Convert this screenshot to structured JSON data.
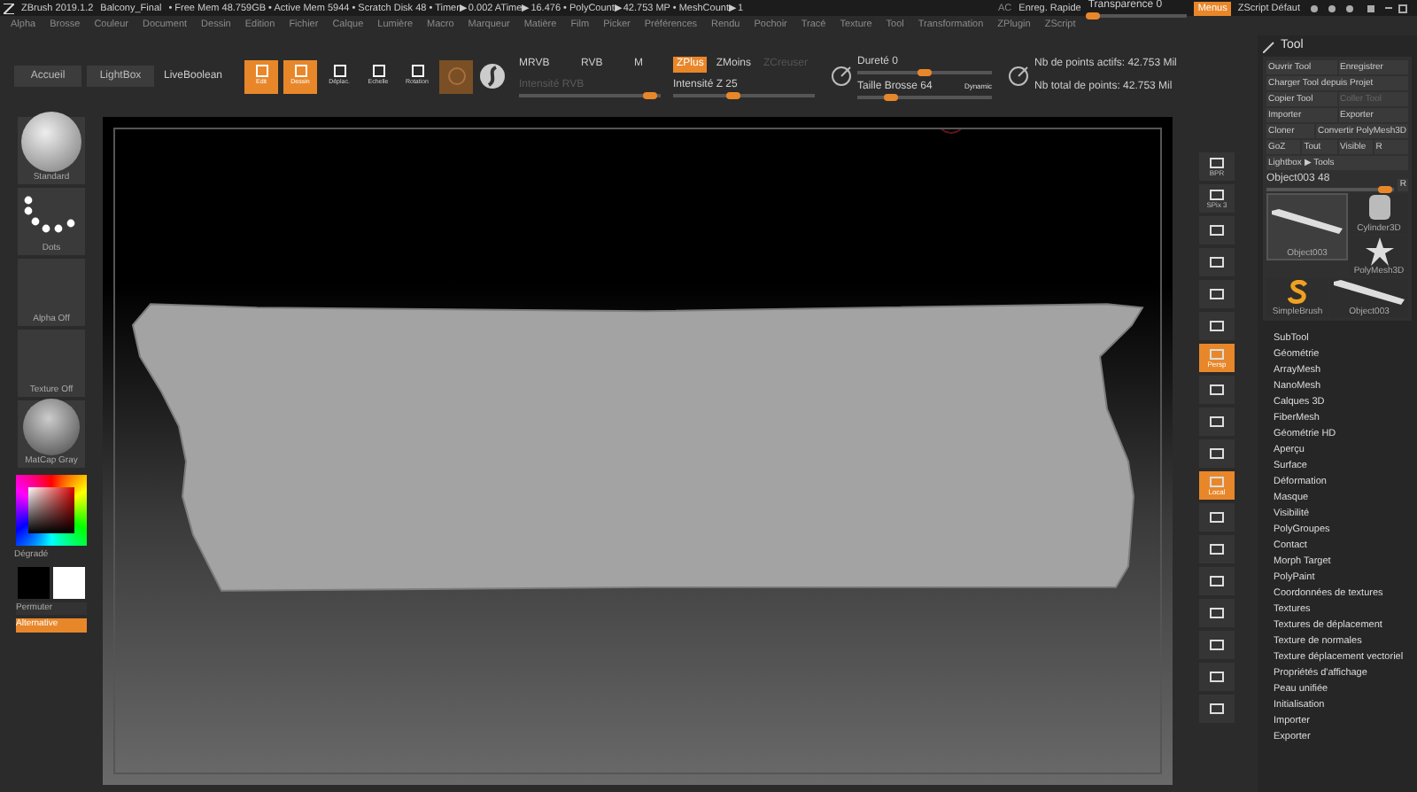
{
  "title_bar": {
    "app": "ZBrush 2019.1.2",
    "file": "Balcony_Final",
    "stats": "• Free Mem 48.759GB • Active Mem 5944 • Scratch Disk 48 • Timer▶0.002 ATime▶16.476 • PolyCount▶42.753 MP • MeshCount▶1",
    "ac": "AC",
    "quick_save": "Enreg. Rapide",
    "transparency": {
      "label": "Transparence 0",
      "level": 0.05
    },
    "menus_button": {
      "label": "Menus",
      "selected": true
    },
    "zscript": "ZScript Défaut"
  },
  "menu_bar": [
    "Alpha",
    "Brosse",
    "Couleur",
    "Document",
    "Dessin",
    "Edition",
    "Fichier",
    "Calque",
    "Lumière",
    "Macro",
    "Marqueur",
    "Matière",
    "Film",
    "Picker",
    "Préférences",
    "Rendu",
    "Pochoir",
    "Tracé",
    "Texture",
    "Tool",
    "Transformation",
    "ZPlugin",
    "ZScript"
  ],
  "toolbar": {
    "nav_buttons": [
      "Accueil",
      "LightBox",
      "LiveBoolean"
    ],
    "modes": [
      {
        "label": "Edit",
        "selected": true
      },
      {
        "label": "Dessin",
        "selected": true
      },
      {
        "label": "Déplac.",
        "selected": false
      },
      {
        "label": "Echelle",
        "selected": false
      },
      {
        "label": "Rotation",
        "selected": false
      }
    ],
    "color_modes": [
      "MRVB",
      "RVB",
      "M"
    ],
    "rgb_intensity": {
      "label": "Intensité RVB",
      "disabled": true,
      "level": 0.92
    },
    "z_modes": [
      {
        "label": "ZPlus",
        "selected": true,
        "disabled": false
      },
      {
        "label": "ZMoins",
        "selected": false,
        "disabled": false
      },
      {
        "label": "ZCreuser",
        "selected": false,
        "disabled": true
      }
    ],
    "z_intensity": {
      "label": "Intensité Z 25",
      "level": 0.42
    },
    "hardness": {
      "label": "Dureté 0",
      "level": 0.5
    },
    "brush_size": {
      "label": "Taille Brosse 64",
      "level": 0.25
    },
    "dynamic": "Dynamic",
    "active_points": "Nb de points actifs: 42.753 Mil",
    "total_points": "Nb total de points: 42.753 Mil"
  },
  "left_panel": {
    "tiles": [
      {
        "kind": "sphere",
        "label": "Standard"
      },
      {
        "kind": "dots",
        "label": "Dots"
      },
      {
        "kind": "empty",
        "label": "Alpha Off"
      },
      {
        "kind": "empty",
        "label": "Texture Off"
      },
      {
        "kind": "matcap",
        "label": "MatCap Gray"
      }
    ],
    "gradient": "Dégradé",
    "swap": "Permuter",
    "alternate": {
      "label": "Alternative",
      "selected": true
    }
  },
  "right_shelf": [
    {
      "label": "BPR",
      "selected": false
    },
    {
      "label": "SPix 3",
      "selected": false
    },
    {
      "selected": false
    },
    {
      "selected": false
    },
    {
      "selected": false
    },
    {
      "selected": false
    },
    {
      "label": "Persp",
      "selected": true
    },
    {
      "selected": false
    },
    {
      "selected": false
    },
    {
      "selected": false
    },
    {
      "label": "Local",
      "selected": true
    },
    {
      "selected": false
    },
    {
      "selected": false
    },
    {
      "selected": false
    },
    {
      "selected": false
    },
    {
      "selected": false
    },
    {
      "selected": false
    },
    {
      "selected": false
    }
  ],
  "tool_panel": {
    "title": "Tool",
    "button_rows": [
      [
        {
          "label": "Ouvrir Tool",
          "disabled": false
        },
        {
          "label": "Enregistrer",
          "disabled": false
        }
      ],
      [
        {
          "label": "Charger Tool depuis Projet",
          "disabled": false
        }
      ],
      [
        {
          "label": "Copier Tool",
          "disabled": false
        },
        {
          "label": "Coller Tool",
          "disabled": true
        }
      ],
      [
        {
          "label": "Importer",
          "disabled": false
        },
        {
          "label": "Exporter",
          "disabled": false
        }
      ],
      [
        {
          "label": "Cloner",
          "disabled": false
        },
        {
          "label": "Convertir PolyMesh3D",
          "disabled": false
        }
      ],
      [
        {
          "label": "GoZ",
          "disabled": false
        },
        {
          "label": "Tout",
          "disabled": false
        },
        {
          "label": "Visible",
          "disabled": false
        },
        {
          "label": "R",
          "disabled": false
        }
      ],
      [
        {
          "label": "Lightbox ▶ Tools",
          "disabled": false
        }
      ]
    ],
    "object_slider": {
      "label": "Object003  48",
      "level": 0.92,
      "reset": "R"
    },
    "thumbnails": [
      {
        "kind": "bar",
        "label": "Object003",
        "selected": true
      },
      {
        "kind": "cylinder",
        "label": "Cylinder3D",
        "selected": false
      },
      {
        "kind": "star",
        "label": "PolyMesh3D",
        "selected": false
      },
      {
        "kind": "brush",
        "label": "SimpleBrush",
        "selected": false
      },
      {
        "kind": "bar",
        "label": "Object003",
        "selected": false
      }
    ],
    "sections": [
      "SubTool",
      "Géométrie",
      "ArrayMesh",
      "NanoMesh",
      "Calques 3D",
      "FiberMesh",
      "Géométrie HD",
      "Aperçu",
      "Surface",
      "Déformation",
      "Masque",
      "Visibilité",
      "PolyGroupes",
      "Contact",
      "Morph Target",
      "PolyPaint",
      "Coordonnées de textures",
      "Textures",
      "Textures de déplacement",
      "Texture de normales",
      "Texture déplacement vectoriel",
      "Propriétés d'affichage",
      "Peau unifiée",
      "Initialisation",
      "Importer",
      "Exporter"
    ]
  }
}
